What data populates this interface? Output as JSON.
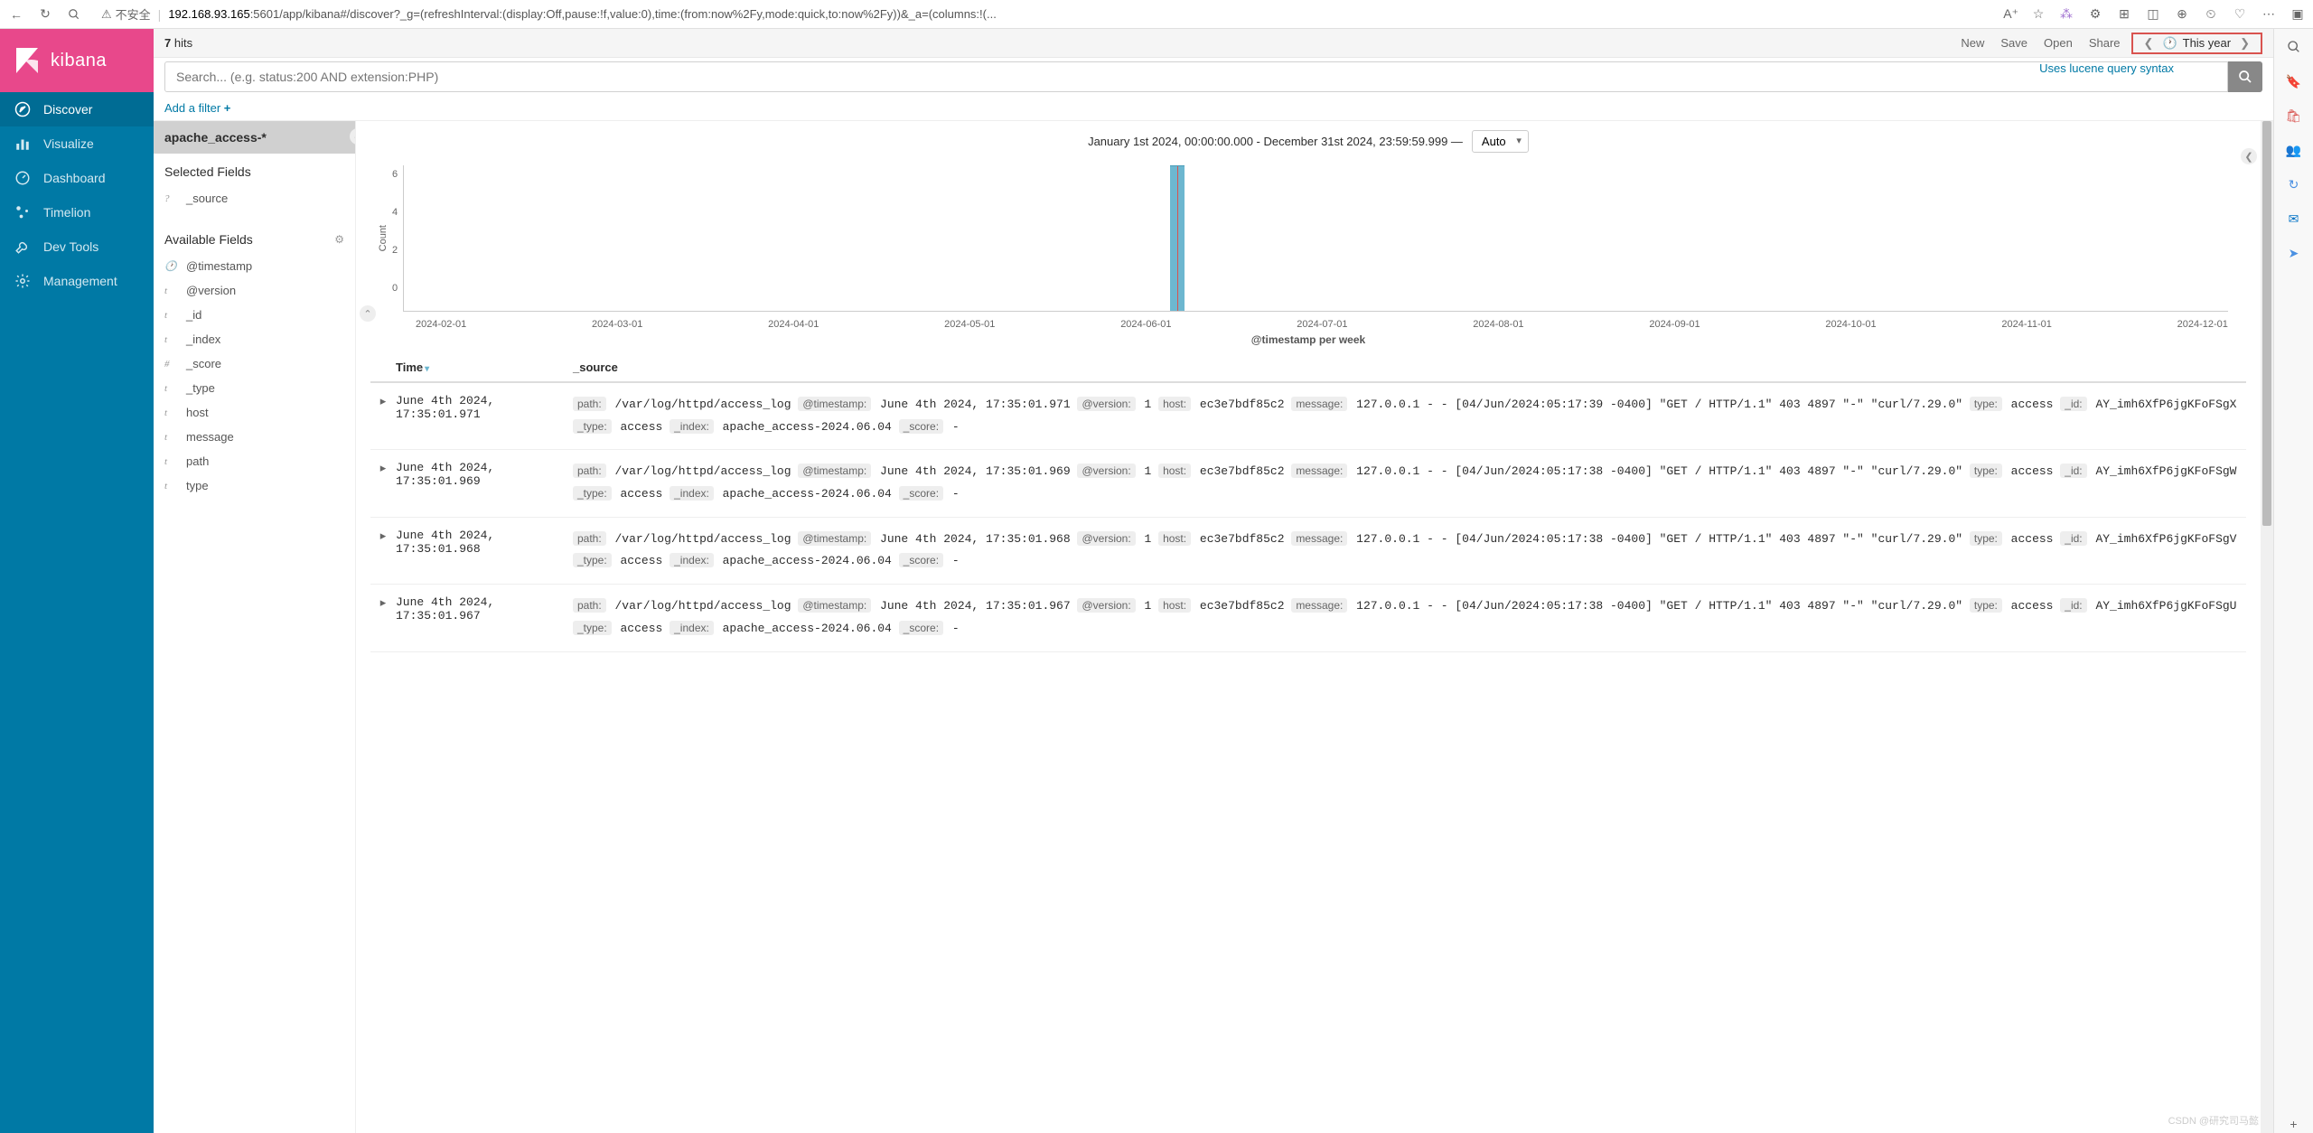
{
  "browser": {
    "security_label": "不安全",
    "url_host": "192.168.93.165",
    "url_path": ":5601/app/kibana#/discover?_g=(refreshInterval:(display:Off,pause:!f,value:0),time:(from:now%2Fy,mode:quick,to:now%2Fy))&_a=(columns:!(..."
  },
  "kibana": {
    "logo_text": "kibana",
    "nav": [
      {
        "label": "Discover",
        "icon": "compass"
      },
      {
        "label": "Visualize",
        "icon": "bar-chart"
      },
      {
        "label": "Dashboard",
        "icon": "gauge"
      },
      {
        "label": "Timelion",
        "icon": "clock-scatter"
      },
      {
        "label": "Dev Tools",
        "icon": "wrench"
      },
      {
        "label": "Management",
        "icon": "gear"
      }
    ]
  },
  "topbar": {
    "hit_number": "7",
    "hit_label": " hits",
    "actions": [
      "New",
      "Save",
      "Open",
      "Share"
    ],
    "time_label": "This year"
  },
  "search": {
    "placeholder": "Search... (e.g. status:200 AND extension:PHP)",
    "lucene_hint": "Uses lucene query syntax"
  },
  "filter": {
    "add_label": "Add a filter "
  },
  "index": {
    "pattern": "apache_access-*"
  },
  "fields": {
    "selected_title": "Selected Fields",
    "selected": [
      {
        "type": "?",
        "name": "_source"
      }
    ],
    "available_title": "Available Fields",
    "available": [
      {
        "type": "clock",
        "name": "@timestamp"
      },
      {
        "type": "t",
        "name": "@version"
      },
      {
        "type": "t",
        "name": "_id"
      },
      {
        "type": "t",
        "name": "_index"
      },
      {
        "type": "#",
        "name": "_score"
      },
      {
        "type": "t",
        "name": "_type"
      },
      {
        "type": "t",
        "name": "host"
      },
      {
        "type": "t",
        "name": "message"
      },
      {
        "type": "t",
        "name": "path"
      },
      {
        "type": "t",
        "name": "type"
      }
    ]
  },
  "timerange": {
    "label": "January 1st 2024, 00:00:00.000 - December 31st 2024, 23:59:59.999 —",
    "interval": "Auto"
  },
  "chart_data": {
    "type": "bar",
    "ylabel": "Count",
    "xlabel": "@timestamp per week",
    "y_ticks": [
      "6",
      "4",
      "2",
      "0"
    ],
    "x_ticks": [
      "2024-02-01",
      "2024-03-01",
      "2024-04-01",
      "2024-05-01",
      "2024-06-01",
      "2024-07-01",
      "2024-08-01",
      "2024-09-01",
      "2024-10-01",
      "2024-11-01",
      "2024-12-01"
    ],
    "bars": [
      {
        "x": "2024-06-01",
        "value": 7,
        "pos_pct": 42
      }
    ],
    "ylim": [
      0,
      7
    ]
  },
  "table": {
    "col_time": "Time",
    "col_source": "_source",
    "rows": [
      {
        "time": "June 4th 2024, 17:35:01.971",
        "fields": {
          "path": "/var/log/httpd/access_log",
          "@timestamp": "June 4th 2024, 17:35:01.971",
          "@version": "1",
          "host": "ec3e7bdf85c2",
          "message": "127.0.0.1 - - [04/Jun/2024:05:17:39 -0400] \"GET / HTTP/1.1\" 403 4897 \"-\" \"curl/7.29.0\"",
          "type": "access",
          "_id": "AY_imh6XfP6jgKFoFSgX",
          "_type": "access",
          "_index": "apache_access-2024.06.04",
          "_score": "-"
        }
      },
      {
        "time": "June 4th 2024, 17:35:01.969",
        "fields": {
          "path": "/var/log/httpd/access_log",
          "@timestamp": "June 4th 2024, 17:35:01.969",
          "@version": "1",
          "host": "ec3e7bdf85c2",
          "message": "127.0.0.1 - - [04/Jun/2024:05:17:38 -0400] \"GET / HTTP/1.1\" 403 4897 \"-\" \"curl/7.29.0\"",
          "type": "access",
          "_id": "AY_imh6XfP6jgKFoFSgW",
          "_type": "access",
          "_index": "apache_access-2024.06.04",
          "_score": "-"
        }
      },
      {
        "time": "June 4th 2024, 17:35:01.968",
        "fields": {
          "path": "/var/log/httpd/access_log",
          "@timestamp": "June 4th 2024, 17:35:01.968",
          "@version": "1",
          "host": "ec3e7bdf85c2",
          "message": "127.0.0.1 - - [04/Jun/2024:05:17:38 -0400] \"GET / HTTP/1.1\" 403 4897 \"-\" \"curl/7.29.0\"",
          "type": "access",
          "_id": "AY_imh6XfP6jgKFoFSgV",
          "_type": "access",
          "_index": "apache_access-2024.06.04",
          "_score": "-"
        }
      },
      {
        "time": "June 4th 2024, 17:35:01.967",
        "fields": {
          "path": "/var/log/httpd/access_log",
          "@timestamp": "June 4th 2024, 17:35:01.967",
          "@version": "1",
          "host": "ec3e7bdf85c2",
          "message": "127.0.0.1 - - [04/Jun/2024:05:17:38 -0400] \"GET / HTTP/1.1\" 403 4897 \"-\" \"curl/7.29.0\"",
          "type": "access",
          "_id": "AY_imh6XfP6jgKFoFSgU",
          "_type": "access",
          "_index": "apache_access-2024.06.04",
          "_score": "-"
        }
      }
    ]
  },
  "watermark": "CSDN @研究司马懿"
}
